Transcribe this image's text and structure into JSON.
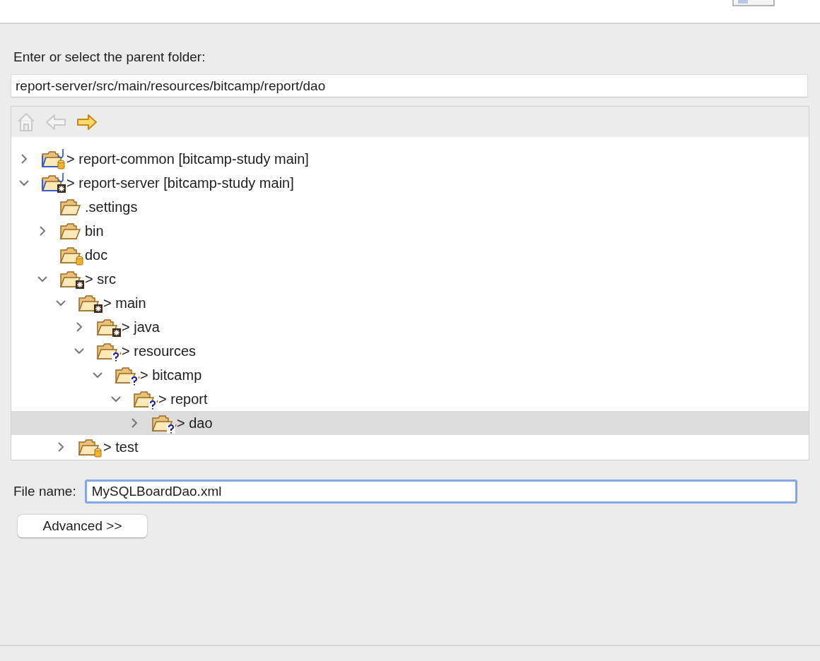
{
  "folder_label": "Enter or select the parent folder:",
  "folder_path": {
    "value": "report-server/src/main/resources/bitcamp/report/dao"
  },
  "toolbar": [
    {
      "kind": "home",
      "disabled": true
    },
    {
      "kind": "back",
      "disabled": true
    },
    {
      "kind": "forward",
      "disabled": false
    }
  ],
  "tree": [
    {
      "label": "> report-common [bitcamp-study main]",
      "kind": "libproject",
      "expanded": false,
      "selected": false
    },
    {
      "label": "> report-server [bitcamp-study main]",
      "kind": "srcproject",
      "expanded": true,
      "selected": false,
      "children": [
        {
          "label": ".settings",
          "kind": "folder",
          "selected": false
        },
        {
          "label": "bin",
          "kind": "folder",
          "expanded": false,
          "selected": false
        },
        {
          "label": "doc",
          "kind": "libfolder",
          "selected": false
        },
        {
          "label": "> src",
          "kind": "srcfolder",
          "expanded": true,
          "selected": false,
          "children": [
            {
              "label": "> main",
              "kind": "srcfolder",
              "expanded": true,
              "selected": false,
              "children": [
                {
                  "label": "> java",
                  "kind": "srcfolder",
                  "expanded": false,
                  "selected": false
                },
                {
                  "label": "> resources",
                  "kind": "newfolder",
                  "expanded": true,
                  "selected": false,
                  "children": [
                    {
                      "label": "> bitcamp",
                      "kind": "newfolder",
                      "expanded": true,
                      "selected": false,
                      "children": [
                        {
                          "label": "> report",
                          "kind": "newfolder",
                          "expanded": true,
                          "selected": false,
                          "children": [
                            {
                              "label": "> dao",
                              "kind": "newfolder",
                              "expanded": false,
                              "selected": true
                            }
                          ]
                        }
                      ]
                    }
                  ]
                }
              ]
            },
            {
              "label": "> test",
              "kind": "libfolder",
              "expanded": false,
              "selected": false
            }
          ]
        }
      ]
    }
  ],
  "file_name": {
    "label": "File name:",
    "value": "MySQLBoardDao.xml",
    "focused": true
  },
  "advanced_button": "Advanced >>"
}
